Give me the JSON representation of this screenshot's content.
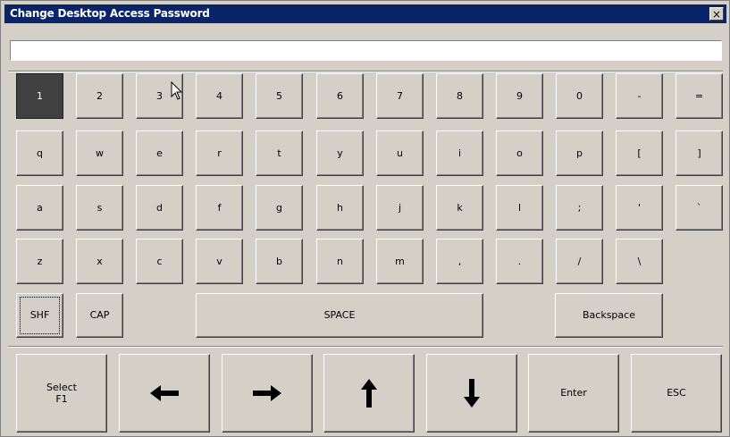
{
  "window": {
    "title": "Change Desktop Access Password",
    "close_label": "×"
  },
  "password_field": {
    "value": ""
  },
  "keyboard": {
    "row1": [
      "1",
      "2",
      "3",
      "4",
      "5",
      "6",
      "7",
      "8",
      "9",
      "0",
      "-",
      "="
    ],
    "row2": [
      "q",
      "w",
      "e",
      "r",
      "t",
      "y",
      "u",
      "i",
      "o",
      "p",
      "[",
      "]"
    ],
    "row3": [
      "a",
      "s",
      "d",
      "f",
      "g",
      "h",
      "j",
      "k",
      "l",
      ";",
      "'",
      "`"
    ],
    "row4": [
      "z",
      "x",
      "c",
      "v",
      "b",
      "n",
      "m",
      ",",
      ".",
      "/",
      "\\"
    ],
    "shift_label": "SHF",
    "caps_label": "CAP",
    "space_label": "SPACE",
    "backspace_label": "Backspace",
    "pressed_key": "1"
  },
  "controls": {
    "select_line1": "Select",
    "select_line2": "F1",
    "left_icon": "arrow-left-icon",
    "right_icon": "arrow-right-icon",
    "up_icon": "arrow-up-icon",
    "down_icon": "arrow-down-icon",
    "enter_label": "Enter",
    "esc_label": "ESC"
  },
  "colors": {
    "titlebar": "#0a246a",
    "face": "#d4d0c8",
    "pressed_key": "#404040"
  }
}
